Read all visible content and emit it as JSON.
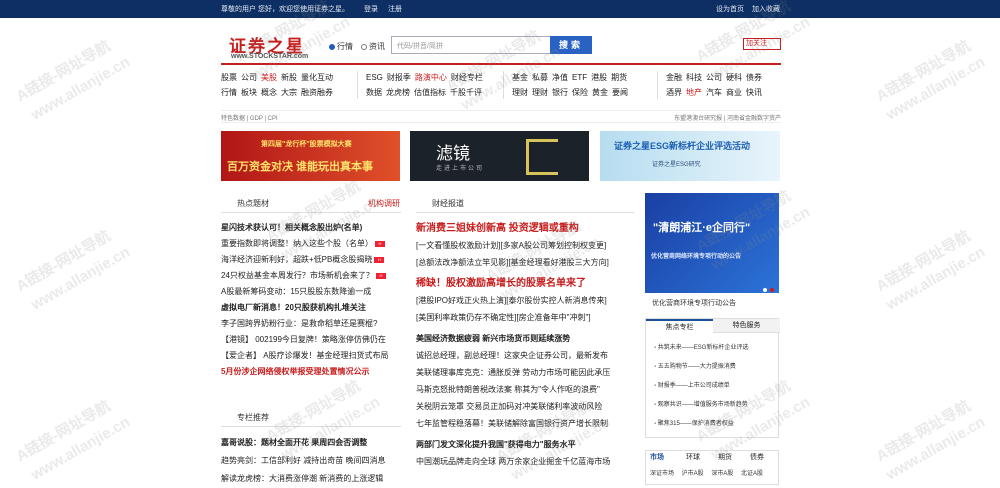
{
  "topbar": {
    "welcome": "尊敬的用户 您好，欢迎您使用证券之星。",
    "login": "登录",
    "register": "注册",
    "home": "设为首页",
    "fav": "加入收藏"
  },
  "header": {
    "logo_cn": "证券之星",
    "logo_en": "www.STOCKSTAR.com",
    "radio1": "行情",
    "radio2": "资讯",
    "search_placeholder": "代码/拼音/简拼",
    "search_btn": "搜索",
    "follow": "加关注"
  },
  "nav": {
    "g1": [
      [
        "股票",
        "公司",
        "美股",
        "新股",
        "量化互动"
      ],
      [
        "行情",
        "板块",
        "概念",
        "大宗",
        "融资融券"
      ]
    ],
    "g2": [
      [
        "ESG",
        "财报季",
        "路演中心",
        "财经专栏"
      ],
      [
        "数据",
        "龙虎榜",
        "估值指标",
        "千股千评"
      ]
    ],
    "g3": [
      [
        "基金",
        "私募",
        "净值",
        "ETF",
        "港股",
        "期货"
      ],
      [
        "理财",
        "理财",
        "银行",
        "保险",
        "黄金",
        "要闻"
      ]
    ],
    "g4": [
      [
        "金融",
        "科技",
        "公司",
        "硬科",
        "债券"
      ],
      [
        "酒界",
        "地产",
        "汽车",
        "商业",
        "快讯"
      ]
    ]
  },
  "subbar": {
    "left": "特色数据 | GDP | CPI",
    "right": "东盟港澳台研究报 | 河南省金融数字资产"
  },
  "banners": {
    "b1_t1": "第四届\"龙行杯\"股票模拟大赛",
    "b1_t2": "百万资金对决 谁能玩出真本事",
    "b2_t1": "滤镜",
    "b2_t2": "走进上市公司",
    "b3_t1": "证券之星ESG新标杆企业评选活动",
    "b3_t2": "证券之星ESG研究"
  },
  "hot": {
    "title": "热点题材",
    "more": "机构调研",
    "items": [
      "星闪技术获认可！相关概念股出炉(名单)",
      "重要指数即将调整！纳入这些个股（名单）",
      "海洋经济迎新利好，超跌+低PB概念股揭晓",
      "24只权益基金本周发行？市场新机会来了？",
      "A股最新筹码变动：15只股股东数降逾一成",
      "虚拟电厂新消息！20只股获机构扎堆关注",
      "李子国跨界奶粉行业：是救命稻草还是赛棍?",
      "【港镜】 002199今日复牌！策略涨停仿佛仍在",
      "【爱企者】 A股疗诊爆发！基金经理扫货式布局",
      "5月份涉企网络侵权举报受理处置情况公示"
    ]
  },
  "column": {
    "title": "专栏推荐",
    "items": [
      "嘉哥说股：题材全面开花 果周四会否调整",
      "趋势亮剑：工信部利好 减持出奇苗 晚间四消息",
      "解读龙虎榜：大消费涨停潮 新消费的上涨逻辑"
    ]
  },
  "news": {
    "title": "财经报道",
    "items": [
      "新消费三姐妹创新高 投资逻辑或重构",
      "[一文看懂股权激励计划][多家A股公司筹划控制权变更]",
      "[总额法改净额法立竿见影][基金经理看好港股三大方向]",
      "稀缺！股权激励高增长的股票名单来了",
      "[港股IPO好戏正火热上演][泰尔股份实控人新消息传来]",
      "[美国利率政策仍存不确定性][房企准备年中\"冲刺\"]",
      "美国经济数据疲弱 新兴市场货币则延续涨势",
      "诚招总经理，副总经理！这家央企证券公司，最新发布",
      "美联储理事库克克：通胀反弹 劳动力市场可能因此承压",
      "马斯克怒批特朗普税改法案 称其为\"令人作呕的浪费\"",
      "关税阴云笼罩 交易员正加码对冲美联储利率波动风险",
      "七年监管程稳落幕！美联储解除富国银行资产增长限制",
      "两部门发文深化提升我国\"获得电力\"服务水平",
      "中国潮玩品牌走向全球 两万余家企业掘金千亿蓝海市场"
    ]
  },
  "right": {
    "banner_t1": "\"清朗浦江·e企同行\"",
    "banner_t2": "优化营商网络环境专项行动的公告",
    "caption": "优化营商环境专项行动公告",
    "tab1": "焦点专栏",
    "tab2": "特色服务",
    "list": [
      "共筑未来——ESG新标杆企业评选",
      "五五购物节——大力提振消费",
      "财报季——上市公司成绩单",
      "观察共识——增值服务市场新趋势",
      "聚焦315——保护消费者权益"
    ],
    "mkt_tabs": [
      "市场",
      "环球",
      "期货",
      "债券"
    ],
    "mkt_row": "深证市场 沪市A股 深市A股 北证A股"
  },
  "watermark": {
    "a": "A链接-网址导航",
    "b": "www.allanjie.cn"
  }
}
